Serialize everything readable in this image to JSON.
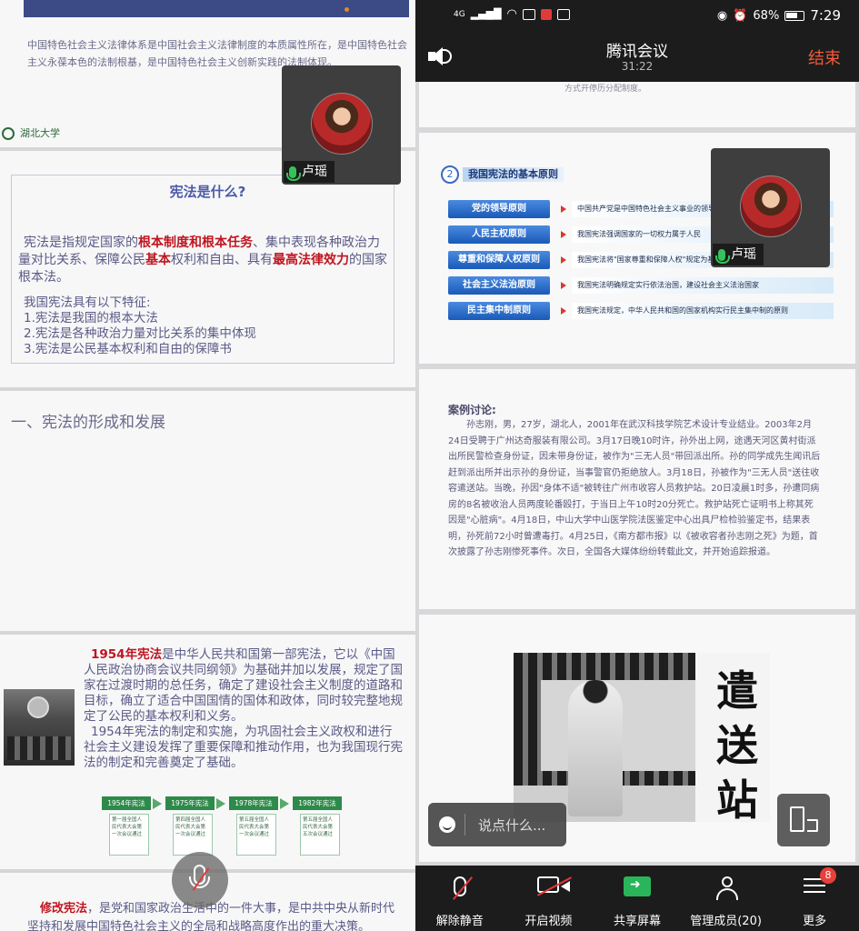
{
  "left": {
    "slide1": {
      "text": "中国特色社会主义法律体系是中国社会主义法律制度的本质属性所在，是中国特色社会主义永葆本色的法制根基，是中国特色社会主义创新实践的法制体现。",
      "logo": "湖北大学"
    },
    "slide2": {
      "title": "宪法是什么?",
      "para_a": "宪法是指规定国家的",
      "para_b": "根本制度和根本任务",
      "para_c": "、集中表现各种政治力量对比关系、保障公民",
      "para_d": "基本",
      "para_e": "权利和自由、具有",
      "para_f": "最高法律效力",
      "para_g": "的国家根本法。",
      "features_title": "我国宪法具有以下特征:",
      "features": [
        "1.宪法是我国的根本大法",
        "2.宪法是各种政治力量对比关系的集中体现",
        "3.宪法是公民基本权利和自由的保障书"
      ]
    },
    "slide3": {
      "heading": "一、宪法的形成和发展"
    },
    "slide4": {
      "red": "1954年宪法",
      "para1": "是中华人民共和国第一部宪法，它以《中国人民政治协商会议共同纲领》为基础并加以发展，规定了国家在过渡时期的总任务，确定了建设社会主义制度的道路和目标，确立了适合中国国情的国体和政体，同时较完整地规定了公民的基本权利和义务。",
      "para2": "1954年宪法的制定和实施，为巩固社会主义政权和进行社会主义建设发挥了重要保障和推动作用，也为我国现行宪法的制定和完善奠定了基础。",
      "timeline": [
        {
          "year": "1954年宪法",
          "desc": "第一届全国人民代表大会第一次会议通过"
        },
        {
          "year": "1975年宪法",
          "desc": "第四届全国人民代表大会第一次会议通过"
        },
        {
          "year": "1978年宪法",
          "desc": "第五届全国人民代表大会第一次会议通过"
        },
        {
          "year": "1982年宪法",
          "desc": "第五届全国人民代表大会第五次会议通过"
        }
      ]
    },
    "slide5": {
      "red": "修改宪法",
      "text": "，是党和国家政治生活中的一件大事，是中共中央从新时代坚持和发展中国特色社会主义的全局和战略高度作出的重大决策。"
    },
    "participant_name": "卢瑶"
  },
  "right": {
    "status": {
      "network": "4G",
      "battery": "68%",
      "time": "7:29"
    },
    "meeting_title": "腾讯会议",
    "elapsed": "31:22",
    "end_label": "结束",
    "slide_top_text": "方式开停历分配制度。",
    "principles": {
      "num": "2",
      "title": "我国宪法的基本原则",
      "rows": [
        {
          "label": "党的领导原则",
          "desc": "中国共产党是中国特色社会主义事业的领导核心"
        },
        {
          "label": "人民主权原则",
          "desc": "我国宪法强调国家的一切权力属于人民"
        },
        {
          "label": "尊重和保障人权原则",
          "desc": "我国宪法将\"国家尊重和保障人权\"规定为基本原则"
        },
        {
          "label": "社会主义法治原则",
          "desc": "我国宪法明确规定实行依法治国，建设社会主义法治国家"
        },
        {
          "label": "民主集中制原则",
          "desc": "我国宪法规定，中华人民共和国的国家机构实行民主集中制的原则"
        }
      ]
    },
    "case": {
      "title": "案例讨论:",
      "text": "孙志刚，男，27岁，湖北人，2001年在武汉科技学院艺术设计专业结业。2003年2月24日受聘于广州达奇服装有限公司。3月17日晚10时许，孙外出上网，途遇天河区黄村街派出所民警检查身份证，因未带身份证，被作为\"三无人员\"带回派出所。孙的同学成先生闻讯后赶到派出所并出示孙的身份证，当事警官仍拒绝放人。3月18日，孙被作为\"三无人员\"送往收容遣送站。当晚，孙因\"身体不适\"被转往广州市收容人员救护站。20日凌晨1时多，孙遭同病房的8名被收治人员两度轮番殴打，于当日上午10时20分死亡。救护站死亡证明书上称其死因是\"心脏病\"。4月18日，中山大学中山医学院法医鉴定中心出具尸检检验鉴定书，结果表明，孙死前72小时曾遭毒打。4月25日，《南方都市报》以《被收容者孙志刚之死》为题，首次披露了孙志刚惨死事件。次日，全国各大媒体纷纷转载此文，并开始追踪报道。"
    },
    "photo_chars": [
      "遣",
      "送",
      "站"
    ],
    "participant_name": "卢瑶",
    "chat_placeholder": "说点什么...",
    "toolbar": [
      {
        "label": "解除静音",
        "icon": "mic-muted-icon"
      },
      {
        "label": "开启视频",
        "icon": "camera-off-icon"
      },
      {
        "label": "共享屏幕",
        "icon": "share-screen-icon"
      },
      {
        "label": "管理成员(20)",
        "icon": "members-icon"
      },
      {
        "label": "更多",
        "icon": "more-icon",
        "badge": "8"
      }
    ]
  }
}
